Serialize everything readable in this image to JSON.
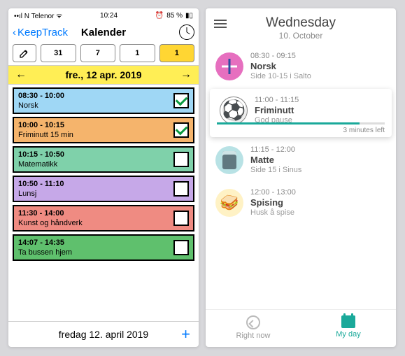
{
  "left": {
    "status": {
      "carrier": "N Telenor",
      "time": "10:24",
      "alarm": "⏰",
      "battery": "85 %",
      "batt_icon": "■"
    },
    "nav": {
      "back": "KeepTrack",
      "title": "Kalender"
    },
    "tabs": {
      "t31": "31",
      "t7": "7",
      "t1a": "1",
      "t1b": "1"
    },
    "datebar": {
      "prev": "←",
      "label": "fre., 12 apr. 2019",
      "next": "→"
    },
    "events": [
      {
        "time": "08:30 - 10:00",
        "title": "Norsk",
        "color": "#9fd7f5",
        "checked": true
      },
      {
        "time": "10:00 - 10:15",
        "title": "Friminutt 15 min",
        "color": "#f5b46c",
        "checked": true
      },
      {
        "time": "10:15 - 10:50",
        "title": "Matematikk",
        "color": "#7fd1aa",
        "checked": false
      },
      {
        "time": "10:50 - 11:10",
        "title": "Lunsj",
        "color": "#c6a8e8",
        "checked": false
      },
      {
        "time": "11:30 - 14:00",
        "title": "Kunst og håndverk",
        "color": "#ef8b82",
        "checked": false
      },
      {
        "time": "14:07 - 14:35",
        "title": "Ta bussen hjem",
        "color": "#5fc06d",
        "checked": false
      }
    ],
    "footer": {
      "date": "fredag 12. april 2019"
    }
  },
  "right": {
    "header": {
      "day": "Wednesday",
      "date": "10. October"
    },
    "items": [
      {
        "time": "08:30 - 09:15",
        "title": "Norsk",
        "detail": "Side 10-15 i Salto",
        "icon": "flag"
      },
      {
        "time": "11:00 - 11:15",
        "title": "Friminutt",
        "detail": "God pause",
        "icon": "soccer",
        "active": true,
        "remaining": "3 minutes left"
      },
      {
        "time": "11:15 - 12:00",
        "title": "Matte",
        "detail": "Side 15 i Sinus",
        "icon": "calc"
      },
      {
        "time": "12:00 - 13:00",
        "title": "Spising",
        "detail": "Husk å spise",
        "icon": "food"
      }
    ],
    "footer": {
      "now": "Right now",
      "day": "My day"
    }
  }
}
